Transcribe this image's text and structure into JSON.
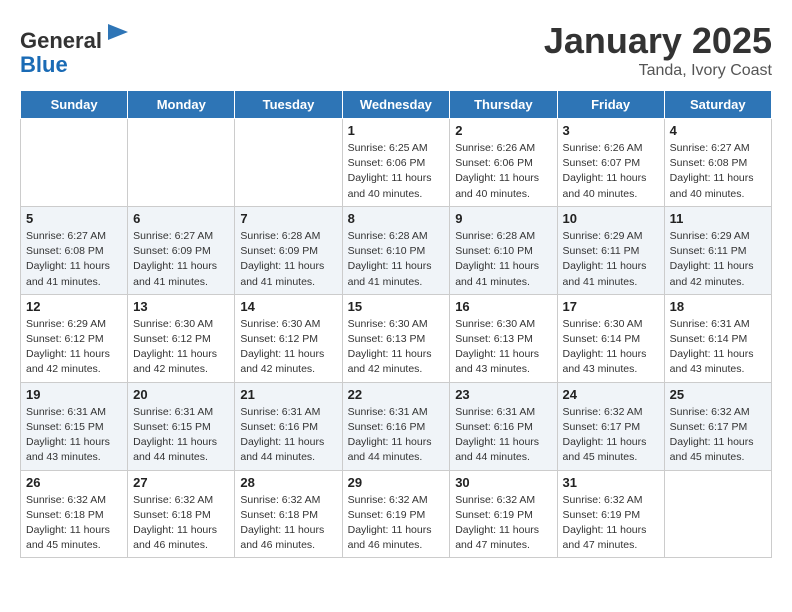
{
  "header": {
    "logo_general": "General",
    "logo_blue": "Blue",
    "month_title": "January 2025",
    "location": "Tanda, Ivory Coast"
  },
  "days_of_week": [
    "Sunday",
    "Monday",
    "Tuesday",
    "Wednesday",
    "Thursday",
    "Friday",
    "Saturday"
  ],
  "weeks": [
    [
      {
        "day": "",
        "info": ""
      },
      {
        "day": "",
        "info": ""
      },
      {
        "day": "",
        "info": ""
      },
      {
        "day": "1",
        "info": "Sunrise: 6:25 AM\nSunset: 6:06 PM\nDaylight: 11 hours and 40 minutes."
      },
      {
        "day": "2",
        "info": "Sunrise: 6:26 AM\nSunset: 6:06 PM\nDaylight: 11 hours and 40 minutes."
      },
      {
        "day": "3",
        "info": "Sunrise: 6:26 AM\nSunset: 6:07 PM\nDaylight: 11 hours and 40 minutes."
      },
      {
        "day": "4",
        "info": "Sunrise: 6:27 AM\nSunset: 6:08 PM\nDaylight: 11 hours and 40 minutes."
      }
    ],
    [
      {
        "day": "5",
        "info": "Sunrise: 6:27 AM\nSunset: 6:08 PM\nDaylight: 11 hours and 41 minutes."
      },
      {
        "day": "6",
        "info": "Sunrise: 6:27 AM\nSunset: 6:09 PM\nDaylight: 11 hours and 41 minutes."
      },
      {
        "day": "7",
        "info": "Sunrise: 6:28 AM\nSunset: 6:09 PM\nDaylight: 11 hours and 41 minutes."
      },
      {
        "day": "8",
        "info": "Sunrise: 6:28 AM\nSunset: 6:10 PM\nDaylight: 11 hours and 41 minutes."
      },
      {
        "day": "9",
        "info": "Sunrise: 6:28 AM\nSunset: 6:10 PM\nDaylight: 11 hours and 41 minutes."
      },
      {
        "day": "10",
        "info": "Sunrise: 6:29 AM\nSunset: 6:11 PM\nDaylight: 11 hours and 41 minutes."
      },
      {
        "day": "11",
        "info": "Sunrise: 6:29 AM\nSunset: 6:11 PM\nDaylight: 11 hours and 42 minutes."
      }
    ],
    [
      {
        "day": "12",
        "info": "Sunrise: 6:29 AM\nSunset: 6:12 PM\nDaylight: 11 hours and 42 minutes."
      },
      {
        "day": "13",
        "info": "Sunrise: 6:30 AM\nSunset: 6:12 PM\nDaylight: 11 hours and 42 minutes."
      },
      {
        "day": "14",
        "info": "Sunrise: 6:30 AM\nSunset: 6:12 PM\nDaylight: 11 hours and 42 minutes."
      },
      {
        "day": "15",
        "info": "Sunrise: 6:30 AM\nSunset: 6:13 PM\nDaylight: 11 hours and 42 minutes."
      },
      {
        "day": "16",
        "info": "Sunrise: 6:30 AM\nSunset: 6:13 PM\nDaylight: 11 hours and 43 minutes."
      },
      {
        "day": "17",
        "info": "Sunrise: 6:30 AM\nSunset: 6:14 PM\nDaylight: 11 hours and 43 minutes."
      },
      {
        "day": "18",
        "info": "Sunrise: 6:31 AM\nSunset: 6:14 PM\nDaylight: 11 hours and 43 minutes."
      }
    ],
    [
      {
        "day": "19",
        "info": "Sunrise: 6:31 AM\nSunset: 6:15 PM\nDaylight: 11 hours and 43 minutes."
      },
      {
        "day": "20",
        "info": "Sunrise: 6:31 AM\nSunset: 6:15 PM\nDaylight: 11 hours and 44 minutes."
      },
      {
        "day": "21",
        "info": "Sunrise: 6:31 AM\nSunset: 6:16 PM\nDaylight: 11 hours and 44 minutes."
      },
      {
        "day": "22",
        "info": "Sunrise: 6:31 AM\nSunset: 6:16 PM\nDaylight: 11 hours and 44 minutes."
      },
      {
        "day": "23",
        "info": "Sunrise: 6:31 AM\nSunset: 6:16 PM\nDaylight: 11 hours and 44 minutes."
      },
      {
        "day": "24",
        "info": "Sunrise: 6:32 AM\nSunset: 6:17 PM\nDaylight: 11 hours and 45 minutes."
      },
      {
        "day": "25",
        "info": "Sunrise: 6:32 AM\nSunset: 6:17 PM\nDaylight: 11 hours and 45 minutes."
      }
    ],
    [
      {
        "day": "26",
        "info": "Sunrise: 6:32 AM\nSunset: 6:18 PM\nDaylight: 11 hours and 45 minutes."
      },
      {
        "day": "27",
        "info": "Sunrise: 6:32 AM\nSunset: 6:18 PM\nDaylight: 11 hours and 46 minutes."
      },
      {
        "day": "28",
        "info": "Sunrise: 6:32 AM\nSunset: 6:18 PM\nDaylight: 11 hours and 46 minutes."
      },
      {
        "day": "29",
        "info": "Sunrise: 6:32 AM\nSunset: 6:19 PM\nDaylight: 11 hours and 46 minutes."
      },
      {
        "day": "30",
        "info": "Sunrise: 6:32 AM\nSunset: 6:19 PM\nDaylight: 11 hours and 47 minutes."
      },
      {
        "day": "31",
        "info": "Sunrise: 6:32 AM\nSunset: 6:19 PM\nDaylight: 11 hours and 47 minutes."
      },
      {
        "day": "",
        "info": ""
      }
    ]
  ]
}
